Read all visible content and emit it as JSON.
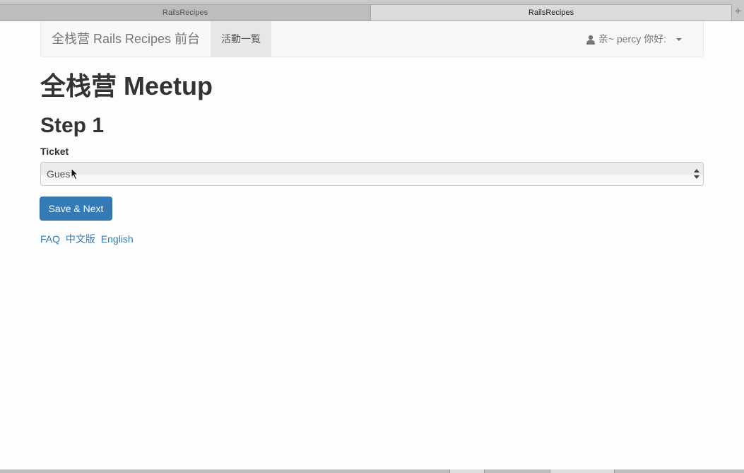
{
  "browser": {
    "tabs": [
      {
        "title": "RailsRecipes",
        "active": false
      },
      {
        "title": "RailsRecipes",
        "active": true
      }
    ],
    "new_tab_icon": "plus-icon"
  },
  "navbar": {
    "brand": "全栈营 Rails Recipes 前台",
    "items": [
      {
        "label": "活動一覧",
        "active": true
      }
    ],
    "user": {
      "icon": "user-icon",
      "greeting": "亲~ percy 你好:"
    }
  },
  "page": {
    "title": "全栈营 Meetup",
    "step_title": "Step 1",
    "ticket_label": "Ticket",
    "ticket_value": "Guest",
    "submit_label": "Save & Next"
  },
  "footer": {
    "links": [
      "FAQ",
      "中文版",
      "English"
    ]
  },
  "colors": {
    "primary": "#337ab7",
    "navbar_bg": "#f8f8f8",
    "active_nav_bg": "#e7e7e7"
  }
}
